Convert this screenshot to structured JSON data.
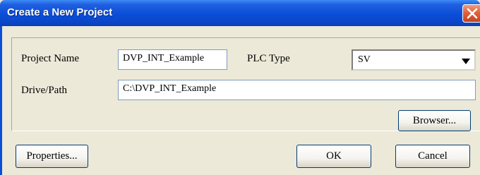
{
  "dialog": {
    "title": "Create a New Project"
  },
  "form": {
    "project_name_label": "Project Name",
    "project_name_value": "DVP_INT_Example",
    "plc_type_label": "PLC Type",
    "plc_type_value": "SV",
    "drive_path_label": "Drive/Path",
    "drive_path_value": "C:\\DVP_INT_Example"
  },
  "buttons": {
    "browser": "Browser...",
    "properties": "Properties...",
    "ok": "OK",
    "cancel": "Cancel"
  },
  "icons": {
    "close": "close-icon",
    "dropdown": "chevron-down-icon"
  },
  "colors": {
    "titlebar": "#0A4ED8",
    "close_button": "#E0623A",
    "dialog_background": "#ECE9D8"
  }
}
